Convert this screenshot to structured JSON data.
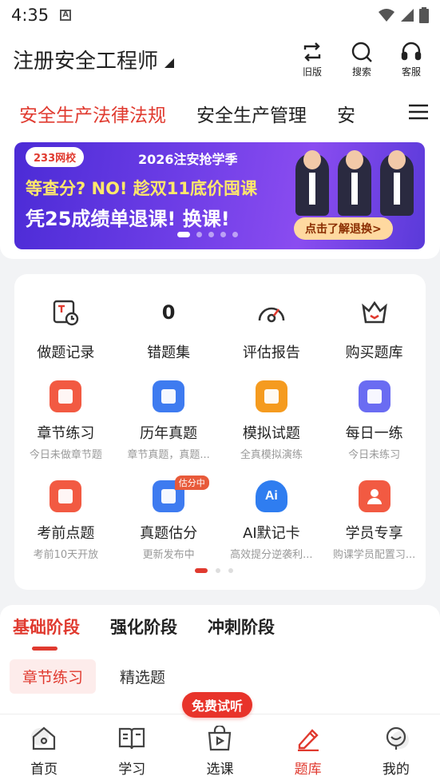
{
  "status_bar": {
    "time": "4:35",
    "notification_letter": "A"
  },
  "header": {
    "title": "注册安全工程师",
    "actions": [
      {
        "label": "旧版",
        "icon": "switch-version-icon"
      },
      {
        "label": "搜索",
        "icon": "search-icon"
      },
      {
        "label": "客服",
        "icon": "headset-icon"
      }
    ]
  },
  "subject_tabs": {
    "items": [
      "安全生产法律法规",
      "安全生产管理",
      "安"
    ],
    "active_index": 0
  },
  "banner": {
    "logo": "233网校",
    "season": "2026注安抢学季",
    "line1": "等查分? NO! 趁双11底价囤课",
    "line2": "凭25成绩单退课! 换课!",
    "cta": "点击了解退换>",
    "pages": 5,
    "active_page": 0
  },
  "quick_stats": [
    {
      "label": "做题记录",
      "icon": "practice-record-icon"
    },
    {
      "label": "错题集",
      "value": "0"
    },
    {
      "label": "评估报告",
      "icon": "assessment-report-icon"
    },
    {
      "label": "购买题库",
      "icon": "buy-question-bank-icon"
    }
  ],
  "features_row1": [
    {
      "label": "章节练习",
      "sub": "今日未做章节题",
      "color": "#f25a42",
      "icon": "chapter-practice-icon"
    },
    {
      "label": "历年真题",
      "sub": "章节真题，真题...",
      "color": "#3e7bf0",
      "icon": "past-exams-icon"
    },
    {
      "label": "模拟试题",
      "sub": "全真模拟演练",
      "color": "#f59b1f",
      "icon": "mock-test-icon"
    },
    {
      "label": "每日一练",
      "sub": "今日未练习",
      "color": "#6a6cf2",
      "icon": "daily-practice-icon"
    }
  ],
  "features_row2": [
    {
      "label": "考前点题",
      "sub": "考前10天开放",
      "color": "#f25a42",
      "icon": "pre-exam-tips-icon"
    },
    {
      "label": "真题估分",
      "sub": "更新发布中",
      "color": "#3e7bf0",
      "icon": "score-estimate-icon",
      "badge": "估分中"
    },
    {
      "label": "AI默记卡",
      "sub": "高效提分逆袭利...",
      "color": "#2f7df0",
      "icon": "ai-flashcard-icon"
    },
    {
      "label": "学员专享",
      "sub": "购课学员配置习...",
      "color": "#f25a42",
      "icon": "student-exclusive-icon"
    }
  ],
  "feature_pages": {
    "count": 3,
    "active": 0
  },
  "stage_tabs": {
    "items": [
      "基础阶段",
      "强化阶段",
      "冲刺阶段"
    ],
    "active_index": 0
  },
  "sub_tabs": {
    "items": [
      "章节练习",
      "精选题"
    ],
    "active_index": 0
  },
  "bottom_nav": {
    "items": [
      {
        "label": "首页",
        "icon": "home-icon"
      },
      {
        "label": "学习",
        "icon": "study-book-icon"
      },
      {
        "label": "选课",
        "icon": "course-bag-icon"
      },
      {
        "label": "题库",
        "icon": "question-bank-pencil-icon"
      },
      {
        "label": "我的",
        "icon": "profile-icon"
      }
    ],
    "active_index": 3,
    "promo_tag": "免费试听"
  },
  "colors": {
    "accent": "#e03a2f",
    "muted": "#999999"
  }
}
